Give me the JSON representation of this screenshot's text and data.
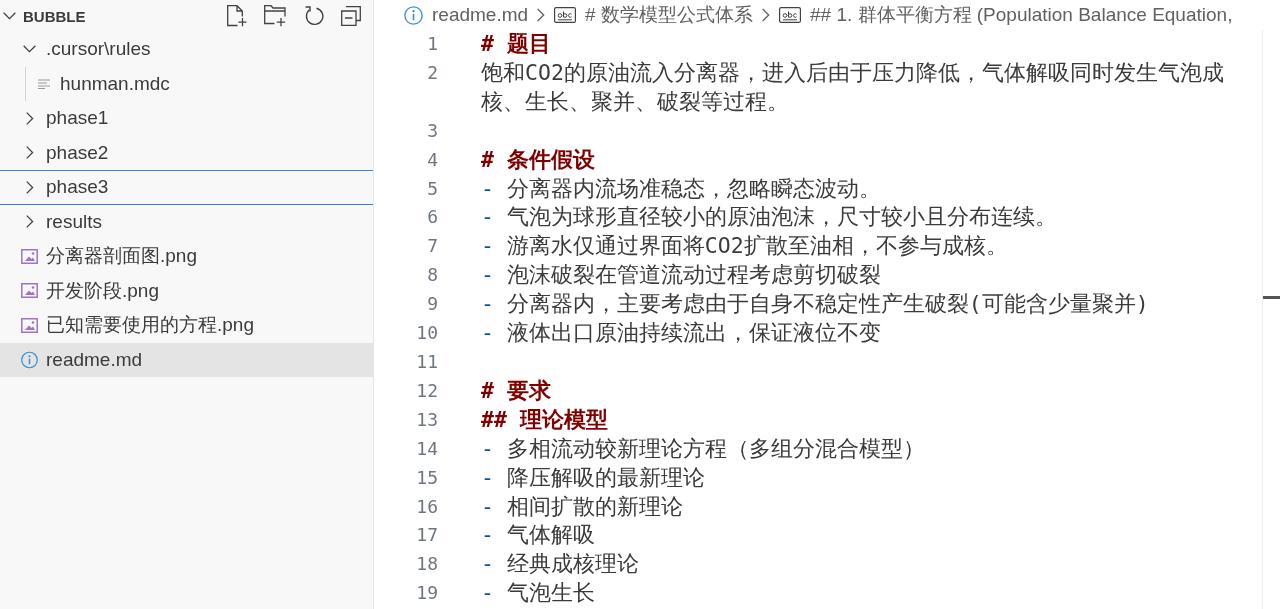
{
  "explorer": {
    "title": "BUBBLE",
    "expanded": true,
    "items": [
      {
        "label": ".cursor\\rules",
        "kind": "folder",
        "expanded": true,
        "selected": false,
        "focused": false,
        "children": [
          {
            "label": "hunman.mdc",
            "kind": "textfile",
            "selected": false,
            "focused": false
          }
        ]
      },
      {
        "label": "phase1",
        "kind": "folder",
        "expanded": false,
        "selected": false,
        "focused": false
      },
      {
        "label": "phase2",
        "kind": "folder",
        "expanded": false,
        "selected": false,
        "focused": false
      },
      {
        "label": "phase3",
        "kind": "folder",
        "expanded": false,
        "selected": false,
        "focused": true
      },
      {
        "label": "results",
        "kind": "folder",
        "expanded": false,
        "selected": false,
        "focused": false
      },
      {
        "label": "分离器剖面图.png",
        "kind": "image",
        "selected": false,
        "focused": false
      },
      {
        "label": "开发阶段.png",
        "kind": "image",
        "selected": false,
        "focused": false
      },
      {
        "label": "已知需要使用的方程.png",
        "kind": "image",
        "selected": false,
        "focused": false
      },
      {
        "label": "readme.md",
        "kind": "readme",
        "selected": true,
        "focused": false
      }
    ]
  },
  "breadcrumb": {
    "file": "readme.md",
    "segments": [
      "# 数学模型公式体系",
      "## 1. 群体平衡方程 (Population Balance Equation,"
    ]
  },
  "editor": {
    "lines": [
      {
        "number": "1",
        "kind": "heading",
        "marker": "#",
        "text": "题目"
      },
      {
        "number": "2",
        "kind": "text",
        "text": "饱和CO2的原油流入分离器，进入后由于压力降低，气体解吸同时发生气泡成核、生长、聚并、破裂等过程。"
      },
      {
        "number": "3",
        "kind": "blank"
      },
      {
        "number": "4",
        "kind": "heading",
        "marker": "#",
        "text": "条件假设"
      },
      {
        "number": "5",
        "kind": "bullet",
        "marker": "-",
        "text": "分离器内流场准稳态，忽略瞬态波动。"
      },
      {
        "number": "6",
        "kind": "bullet",
        "marker": "-",
        "text": "气泡为球形直径较小的原油泡沫，尺寸较小且分布连续。"
      },
      {
        "number": "7",
        "kind": "bullet",
        "marker": "-",
        "text": "游离水仅通过界面将CO2扩散至油相，不参与成核。"
      },
      {
        "number": "8",
        "kind": "bullet",
        "marker": "-",
        "text": "泡沫破裂在管道流动过程考虑剪切破裂"
      },
      {
        "number": "9",
        "kind": "bullet",
        "marker": "-",
        "text": "分离器内，主要考虑由于自身不稳定性产生破裂(可能含少量聚并)"
      },
      {
        "number": "10",
        "kind": "bullet",
        "marker": "-",
        "text": "液体出口原油持续流出，保证液位不变"
      },
      {
        "number": "11",
        "kind": "blank"
      },
      {
        "number": "12",
        "kind": "heading",
        "marker": "#",
        "text": "要求"
      },
      {
        "number": "13",
        "kind": "heading",
        "marker": "##",
        "text": "理论模型"
      },
      {
        "number": "14",
        "kind": "bullet",
        "marker": "-",
        "text": "多相流动较新理论方程（多组分混合模型）"
      },
      {
        "number": "15",
        "kind": "bullet",
        "marker": "-",
        "text": "降压解吸的最新理论"
      },
      {
        "number": "16",
        "kind": "bullet",
        "marker": "-",
        "text": "相间扩散的新理论"
      },
      {
        "number": "17",
        "kind": "bullet",
        "marker": "-",
        "text": "气体解吸"
      },
      {
        "number": "18",
        "kind": "bullet",
        "marker": "-",
        "text": "经典成核理论"
      },
      {
        "number": "19",
        "kind": "bullet",
        "marker": "-",
        "text": "气泡生长"
      }
    ]
  }
}
